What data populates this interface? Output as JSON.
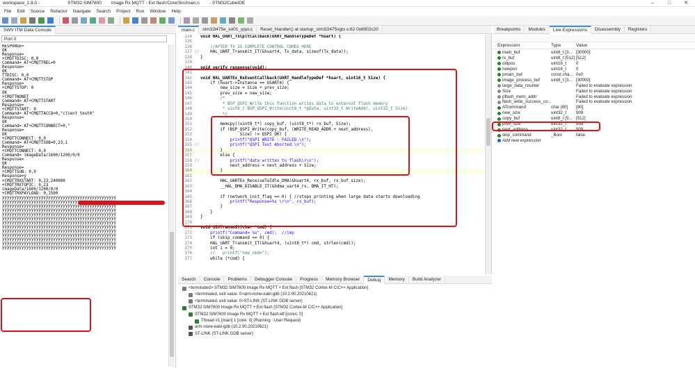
{
  "titlebar": {
    "workspace": "workspace_1.8.0 -",
    "project": "STM32 SIM7600",
    "path": "Image Rx MQTT - Ext flash/Core/Src/main.c",
    "app": "- STM32CubeIDE"
  },
  "menu": [
    "File",
    "Edit",
    "Source",
    "Refactor",
    "Navigate",
    "Search",
    "Project",
    "Run",
    "Window",
    "Help"
  ],
  "console": {
    "tab": "SWV ITM Data Console",
    "port": "Port 0",
    "lines": [
      "RESPONSE=",
      "OK",
      "",
      "Response=",
      "+CMQTTDISC: 0,0",
      "",
      "Command= AT+CMQTTREL=0",
      "Response=",
      "OK",
      "TTDISC: 0,0",
      "",
      "Command= AT+CMQTTSTOP",
      "Response=",
      "+CMQTTSTOP: 0",
      "",
      "OK",
      "",
      "+CMQTTNONET",
      "",
      "Command= AT+CMQTTSTART",
      "Response=",
      "+CMQTTSTART: 0",
      "",
      "",
      "Command= AT+CMQTTACCQ=0,\"client test0\"",
      "Response=",
      "OK",
      "",
      "Command= AT+CMQTTCONNECT=0,\"",
      "Response=",
      "OK",
      "",
      "+CMQTTCONNECT: 0,0",
      "",
      "Command= AT+CMQTTSUB=0,23,1",
      "Response=",
      "+CMQTTCONNECT: 0,0",
      "",
      "Command= imageData/1600/1200/0/0",
      "Response=",
      "OK",
      "",
      "Response=",
      "+CMQTTSUB: 0,0",
      "",
      "Response=y",
      "+CMQTTRXSTART: 0,23,240000",
      "+CMQTTRXTOPIC: 0,23",
      "imageData/1600/1200/0/0",
      "+CMQTTRXPAYLOAD: 0,1500",
      "yyyyyyyyyyyyyyyyyyyyyyyyyyyyyyyyyyyyyyyyyyyyyyy",
      "yyyyyyyyyyyyyyyyyyyyyyyyyyyyyyyyyyyyyyyyyyyyyyy",
      "yyyyyyyyyyyyyyyyyyyyyyyyyyyyyyyyyyyyyyyyyyyyyyy",
      "yyyyyyyyyyyyyyyyyyyyyyyyyyyyyyyyyyyyyyyyyyyyyyy",
      "yyyyyyyyyyyyyyyyyyyyyyyyyyyyyyyyyyyyyyyyyyyyyyy",
      "yyyyyyyyyyyyyyyyyyyyyyyyyyyyyyyyyyyyyyyyyyyyyyy",
      "yyyyyyyyyyyyyyyyyyyyyyyyyyyyyyyyyyyyyyyyyyyyyyy",
      "yyyyyyyyyyyyyyyyyyyyyyyyyyyyyyyyyyyyyyyyyyyyyyy",
      "yyyyyyyyyyyyyyyyyyyyyyyyyyyyyyyyyyyyyyyyyyyyyyy",
      "yyyyyyyyyyyyyyyyyyyyyyyyyyyyyyyyyyyyyyyyyyyyyyy",
      "yyyyyyyyyyyyyyyyyyyyyyyyyyyyyyyyyyyyyyyyyyyyyyy",
      "yyyyyyyyyyyyyyyyyyyyyyyyyyyyyyyyyyyyyyyyyyyyyyy",
      "yyyyyyyyyyyyyyyyyyyyyyyyyyyyyyyyyyyyyyyyyyyyyyy"
    ]
  },
  "editor": {
    "tabs": [
      "main.c",
      "stm32l475e_iot01_qspi.c",
      "Reset_Handler() at startup_stm32l475vgtx.s:62 0x8002c20"
    ],
    "lines": [
      {
        "n": "134",
        "m": "",
        "t": "void HAL_UART_TxCpltCallback(UART_HandleTypeDef *huart) {"
      },
      {
        "n": "135",
        "m": "",
        "t": ""
      },
      {
        "n": "136",
        "m": "",
        "t": "    //AFTER TX IS COMPLETE CONTROL COMES HERE"
      },
      {
        "n": "137",
        "m": "//",
        "t": "    HAL_UART_Transmit_IT(&huart4, Tx_data, sizeof(Tx_data));"
      },
      {
        "n": "138",
        "m": "",
        "t": "}"
      },
      {
        "n": "139",
        "m": "",
        "t": ""
      },
      {
        "n": "140",
        "m": "",
        "t": "void verify_response(void);"
      },
      {
        "n": "141",
        "m": "",
        "t": ""
      },
      {
        "n": "142",
        "m": "",
        "t": "void HAL_UARTEx_RxEventCallback(UART_HandleTypeDef *huart, uint16_t Size) {"
      },
      {
        "n": "143",
        "m": "",
        "t": "    if (huart->Instance == USART4) {"
      },
      {
        "n": "144",
        "m": "",
        "t": "        new_size = Size + prev_size;"
      },
      {
        "n": "145",
        "m": "",
        "t": "        prev_size = new_size;"
      },
      {
        "n": "146",
        "m": "",
        "t": "        /*"
      },
      {
        "n": "147",
        "m": "",
        "t": "         * BSP_QSPI_Write this function writes data to external flash memory"
      },
      {
        "n": "148",
        "m": "",
        "t": "         * uint8_t BSP_QSPI_Write(uint8_t *pData, uint32_t WriteAddr, uint32_t Size)"
      },
      {
        "n": "149",
        "m": "",
        "t": "         */"
      },
      {
        "n": "150",
        "m": "",
        "t": ""
      },
      {
        "n": "151",
        "m": "",
        "t": "        memcpy((uint8_t*) copy_buf, (uint8_t*) rx_buf, Size);"
      },
      {
        "n": "152",
        "m": "",
        "t": "        if (BSP_QSPI_Write(copy_buf, (WRITE_READ_ADDR + next_address),"
      },
      {
        "n": "153",
        "m": "",
        "t": "                Size) != QSPI_OK) {"
      },
      {
        "n": "154",
        "m": "",
        "t": "            printf(\"QSPI WRITE : FAILED.\\n\");"
      },
      {
        "n": "155",
        "m": "//",
        "t": "            printf(\"QSPI Test Aborted.\\n\");"
      },
      {
        "n": "156",
        "m": "",
        "t": "        }"
      },
      {
        "n": "157",
        "m": "",
        "t": "        else {"
      },
      {
        "n": "158",
        "m": "//",
        "t": "            printf(\"data written to flash\\r\\n\");"
      },
      {
        "n": "159",
        "m": "",
        "t": "            next_address = next_address + Size;"
      },
      {
        "n": "160",
        "m": "",
        "t": "        }"
      },
      {
        "n": "161",
        "m": "",
        "t": ""
      },
      {
        "n": "162",
        "m": "",
        "t": "        HAL_UARTEx_ReceiveToIdle_DMA(&huart4, rx_buf, rx_buf_size);"
      },
      {
        "n": "163",
        "m": "",
        "t": "        __HAL_DMA_DISABLE_IT(&hdma_uart4_rx, DMA_IT_HT);"
      },
      {
        "n": "164",
        "m": "",
        "t": ""
      },
      {
        "n": "165",
        "m": "",
        "t": "        if (network_init_flag == 0) { //stops printing when large data starts downloading"
      },
      {
        "n": "166",
        "m": "",
        "t": "            printf(\"Response=%s \\r\\n\", rx_buf);"
      },
      {
        "n": "167",
        "m": "",
        "t": "        }"
      },
      {
        "n": "168",
        "m": "",
        "t": "    }"
      },
      {
        "n": "169",
        "m": "",
        "t": "}"
      },
      {
        "n": "170",
        "m": "",
        "t": ""
      },
      {
        "n": "171",
        "m": "",
        "t": "void SIMTransmit(char *cmd) {"
      },
      {
        "n": "172",
        "m": "",
        "t": "    printf(\"Command= %s\", cmd);  //imp"
      },
      {
        "n": "173",
        "m": "",
        "t": "    if (skip_command == 0) {"
      },
      {
        "n": "174",
        "m": "",
        "t": "    HAL_UART_Transmit_IT(&huart4, (uint8_t*) cmd, strlen(cmd));"
      },
      {
        "n": "175",
        "m": "",
        "t": "    int i = 0;"
      },
      {
        "n": "176",
        "m": "",
        "t": "    //   printf(\"new_cmd=\");"
      },
      {
        "n": "177",
        "m": "",
        "t": "    while (*cmd) {"
      }
    ]
  },
  "bottom": {
    "tabs": [
      "Search",
      "Console",
      "Problems",
      "Debugger Console",
      "Progress",
      "Memory Browser",
      "Debug",
      "Memory",
      "Build Analyzer"
    ],
    "rows": [
      {
        "t": "<terminated>  STM32 SIM7600  Image Rx MQTT + Ext flash [STM32 Cortex-M C/C++ Application]",
        "ind": 0,
        "c": "#7a7a7a"
      },
      {
        "t": "<terminated, exit value: 0>arm-none-eabi-gdb (10.2.90.20210621)",
        "ind": 1,
        "c": "#7a7a7a"
      },
      {
        "t": "<terminated, exit value: 0>ST-LINK (ST-LINK GDB server)",
        "ind": 1,
        "c": "#7a7a7a"
      },
      {
        "t": "STM32 SIM7600  Image Rx MQTT + Ext flash [STM32 Cortex-M C/C++ Application]",
        "ind": 0,
        "c": "#2e7d32"
      },
      {
        "t": "STM32 SIM7600  Image Rx MQTT + Ext flash.elf [cores: 0]",
        "ind": 1,
        "c": "#2e7d32"
      },
      {
        "t": "Thread #1 [main] 1 [core: 0] (Running : User Request)",
        "ind": 2,
        "c": "#2e7d32"
      },
      {
        "t": "arm-none-eabi-gdb (10.2.90.20210621)",
        "ind": 1,
        "c": "#555"
      },
      {
        "t": "ST-LINK (ST-LINK GDB server)",
        "ind": 1,
        "c": "#555"
      }
    ]
  },
  "expressions": {
    "tabs": [
      "Breakpoints",
      "Modules",
      "Live Expressions",
      "Disassembly",
      "Registers"
    ],
    "headers": [
      "Expression",
      "Type",
      "Value"
    ],
    "rows": [
      {
        "e": "main_buf",
        "t": "uint8_t [3...",
        "v": "[30000]",
        "c": "#2e7d32"
      },
      {
        "e": "rx_buf",
        "t": "uint8_t [512]",
        "v": "[512]",
        "c": "#2e7d32"
      },
      {
        "e": "oldpos",
        "t": "uint16_t",
        "v": "0",
        "c": "#2e7d32"
      },
      {
        "e": "newpos",
        "t": "uint16_t",
        "v": "0",
        "c": "#2e7d32"
      },
      {
        "e": "pmain_buf",
        "t": "const cha...",
        "v": "0x0",
        "c": "#2e7d32"
      },
      {
        "e": "image_process_buf",
        "t": "uint8_t [3...",
        "v": "[30000]",
        "c": "#2e7d32"
      },
      {
        "e": "large_data_counter",
        "t": "",
        "v": "Failed to evaluate expression",
        "c": "#888"
      },
      {
        "e": "Size",
        "t": "",
        "v": "Failed to evaluate expression",
        "c": "#888"
      },
      {
        "e": "pflash_mem_addr",
        "t": "",
        "v": "Failed to evaluate expression",
        "c": "#888"
      },
      {
        "e": "flash_write_success_co...",
        "t": "",
        "v": "Failed to evaluate expression",
        "c": "#888"
      },
      {
        "e": "ATcommand",
        "t": "char [80]",
        "v": "[80]",
        "c": "#2e7d32"
      },
      {
        "e": "new_size",
        "t": "uint32_t",
        "v": "909",
        "c": "#2e7d32"
      },
      {
        "e": "copy_buf",
        "t": "uint8_t [5...",
        "v": "[512]",
        "c": "#2e7d32"
      },
      {
        "e": "prev_size",
        "t": "uint32_t",
        "v": "909",
        "c": "#2e7d32"
      },
      {
        "e": "next_address",
        "t": "uint32_t",
        "v": "909",
        "c": "#2e7d32"
      },
      {
        "e": "skip_command",
        "t": "_Bool",
        "v": "false",
        "c": "#2e7d32"
      },
      {
        "e": "Add new expression",
        "t": "",
        "v": "",
        "c": "#1565c0"
      }
    ]
  }
}
